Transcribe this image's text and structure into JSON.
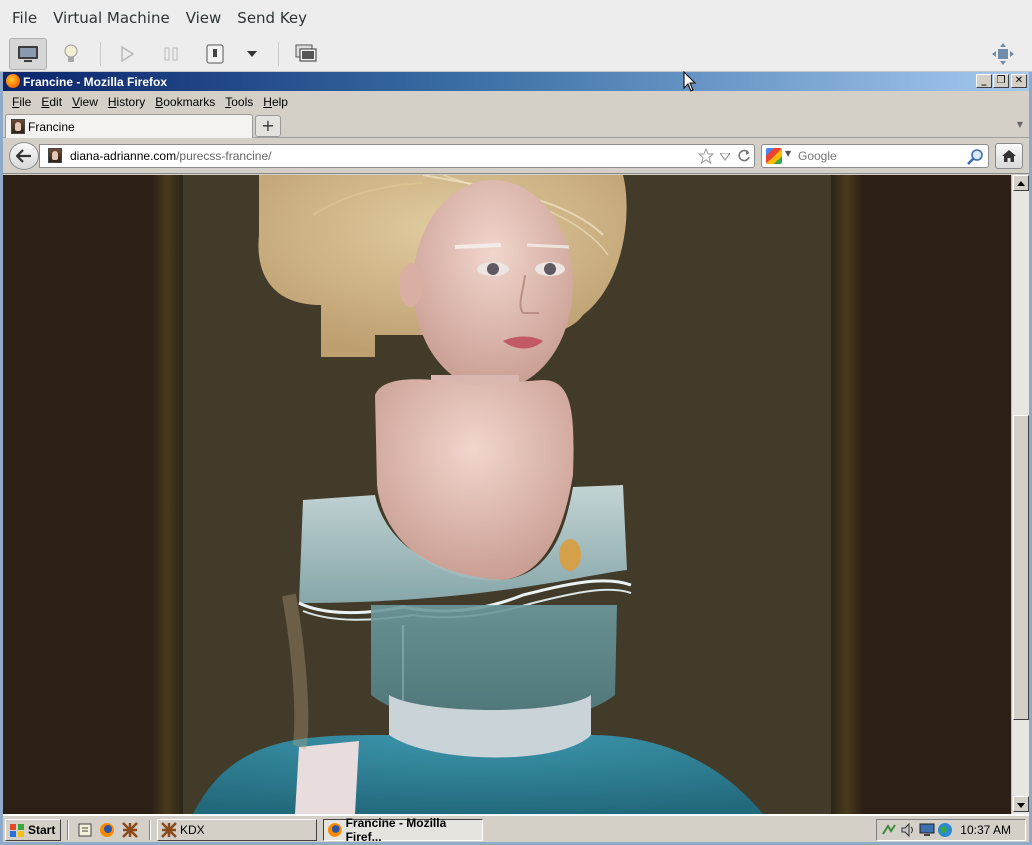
{
  "vm": {
    "menu": [
      "File",
      "Virtual Machine",
      "View",
      "Send Key"
    ],
    "toolbar": {
      "icons": [
        "monitor-icon",
        "lightbulb-icon",
        "play-icon",
        "pause-icon",
        "power-icon",
        "dropdown-icon",
        "screens-icon",
        "fullscreen-icon"
      ]
    }
  },
  "firefox": {
    "window_title": "Francine - Mozilla Firefox",
    "title_buttons": [
      "_",
      "❐",
      "✕"
    ],
    "menu": [
      "File",
      "Edit",
      "View",
      "History",
      "Bookmarks",
      "Tools",
      "Help"
    ],
    "tab": {
      "label": "Francine"
    },
    "new_tab_label": "+",
    "url": {
      "domain": "diana-adrianne.com",
      "path": "/purecss-francine/"
    },
    "search": {
      "placeholder": "Google"
    }
  },
  "taskbar": {
    "start_label": "Start",
    "tasks": [
      {
        "label": "KDX"
      },
      {
        "label": "Francine - Mozilla Firef..."
      }
    ],
    "clock": "10:37 AM"
  },
  "colors": {
    "title_gradient_start": "#0a246a",
    "title_gradient_end": "#a6caf0",
    "painting_background": "#423b2a",
    "dress": "#2e7f95"
  }
}
